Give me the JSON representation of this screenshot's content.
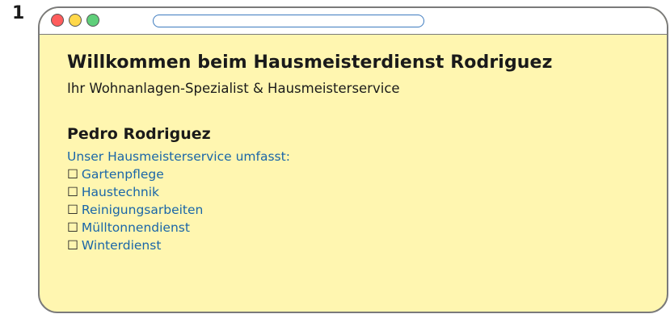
{
  "step_number": "1",
  "window": {
    "address_bar_value": "",
    "traffic_lights": {
      "close_color": "#ff5c5c",
      "minimize_color": "#ffd84a",
      "maximize_color": "#5fcf7a"
    },
    "background_color": "#fff6b0"
  },
  "page": {
    "title": "Willkommen beim Hausmeisterdienst Rodriguez",
    "subtitle": "Ihr Wohnanlagen-Spezialist & Hausmeisterservice",
    "person_name": "Pedro Rodriguez",
    "services_intro": "Unser Hausmeisterservice umfasst:",
    "checkbox_glyph": "☐",
    "services": [
      {
        "label": "Gartenpflege"
      },
      {
        "label": "Haustechnik"
      },
      {
        "label": "Reinigungsarbeiten"
      },
      {
        "label": "Mülltonnendienst"
      },
      {
        "label": "Winterdienst"
      }
    ],
    "link_color": "#1a66a8"
  }
}
